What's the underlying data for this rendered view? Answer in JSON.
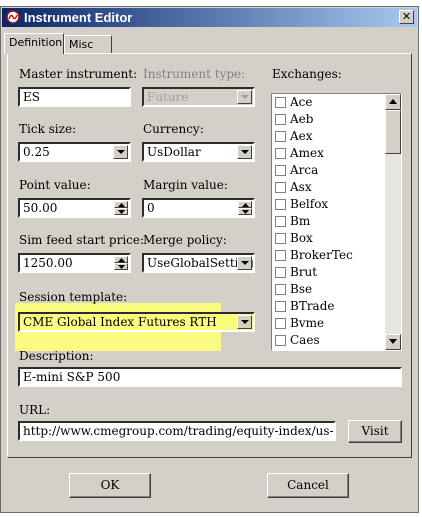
{
  "window": {
    "title": "Instrument Editor",
    "close_glyph": "✕"
  },
  "tabs": [
    {
      "label": "Definition"
    },
    {
      "label": "Misc"
    }
  ],
  "fields": {
    "master_instrument": {
      "label": "Master instrument:",
      "value": "ES"
    },
    "instrument_type": {
      "label": "Instrument type:",
      "value": "Future"
    },
    "tick_size": {
      "label": "Tick size:",
      "value": "0.25"
    },
    "currency": {
      "label": "Currency:",
      "value": "UsDollar"
    },
    "point_value": {
      "label": "Point value:",
      "value": "50.00"
    },
    "margin_value": {
      "label": "Margin value:",
      "value": "0"
    },
    "sim_feed_start_price": {
      "label": "Sim feed start price:",
      "value": "1250.00"
    },
    "merge_policy": {
      "label": "Merge policy:",
      "value": "UseGlobalSettings"
    },
    "session_template": {
      "label": "Session template:",
      "value": "CME Global Index Futures RTH"
    },
    "description": {
      "label": "Description:",
      "value": "E-mini S&P 500"
    },
    "url": {
      "label": "URL:",
      "value": "http://www.cmegroup.com/trading/equity-index/us-index/e-mini-sa"
    }
  },
  "exchanges": {
    "label": "Exchanges:",
    "items": [
      "Ace",
      "Aeb",
      "Aex",
      "Amex",
      "Arca",
      "Asx",
      "Belfox",
      "Bm",
      "Box",
      "BrokerTec",
      "Brut",
      "Bse",
      "BTrade",
      "Bvme",
      "Caes"
    ]
  },
  "buttons": {
    "visit": "Visit",
    "ok": "OK",
    "cancel": "Cancel"
  },
  "colors": {
    "highlight": "#fafb80",
    "titlebar_start": "#0a246a",
    "titlebar_end": "#a6caf0",
    "window_bg": "#d4d0c8"
  },
  "icons": {
    "app": "ninja-logo-icon",
    "close": "close-icon",
    "dropdown": "chevron-down-icon",
    "spin_up": "spin-up-icon",
    "spin_down": "spin-down-icon"
  }
}
